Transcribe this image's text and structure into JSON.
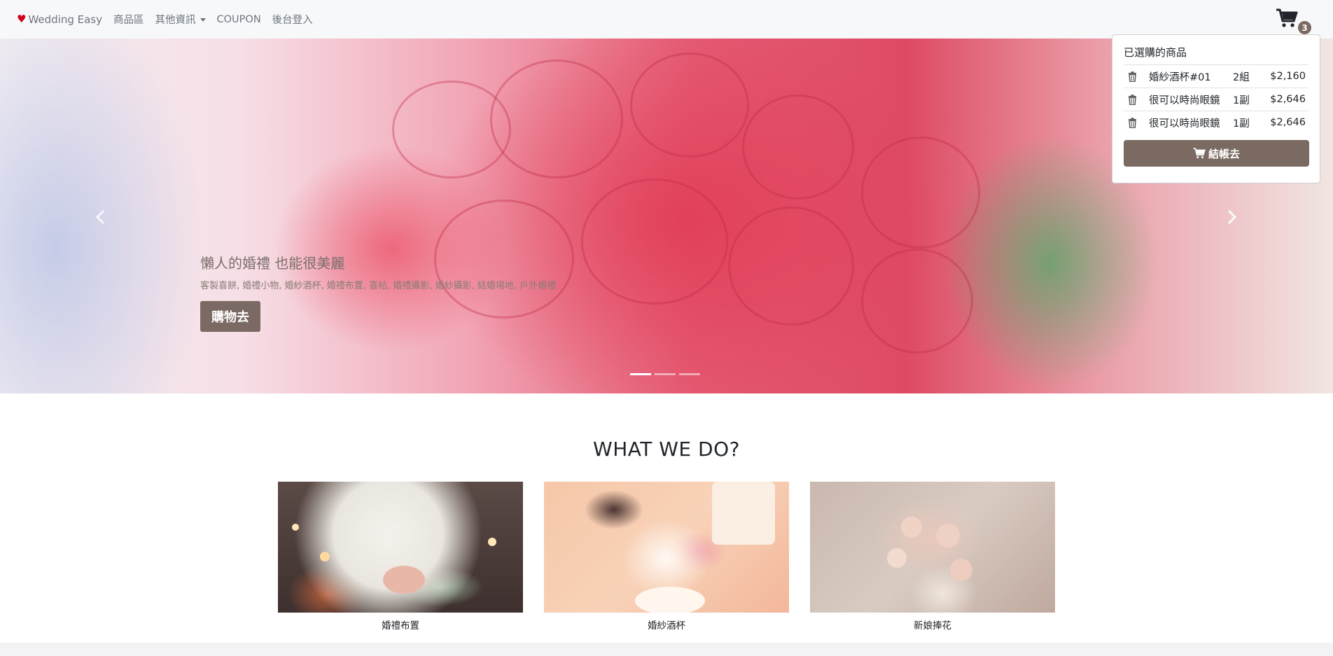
{
  "navbar": {
    "brand": "Wedding Easy",
    "links": [
      "商品區",
      "其他資訊",
      "COUPON",
      "後台登入"
    ],
    "cart_count": "3"
  },
  "hero": {
    "title": "懶人的婚禮 也能很美麗",
    "subtitle": "客製喜餅, 婚禮小物, 婚紗酒杯, 婚禮布置, 喜帖, 婚禮攝影, 婚紗攝影, 結婚場地, 戶外婚禮",
    "button": "購物去",
    "slides": 3,
    "active_slide": 1
  },
  "cart_panel": {
    "heading": "已選購的商品",
    "items": [
      {
        "name": "婚紗酒杯#01",
        "qty": "2組",
        "price": "$2,160"
      },
      {
        "name": "很可以時尚眼鏡",
        "qty": "1副",
        "price": "$2,646"
      },
      {
        "name": "很可以時尚眼鏡",
        "qty": "1副",
        "price": "$2,646"
      }
    ],
    "checkout": "結帳去"
  },
  "main": {
    "section_title": "WHAT WE DO?",
    "cards": [
      "婚禮布置",
      "婚紗酒杯",
      "新娘捧花"
    ]
  },
  "colors": {
    "accent": "#7a6a62",
    "heart": "#d0021b"
  }
}
